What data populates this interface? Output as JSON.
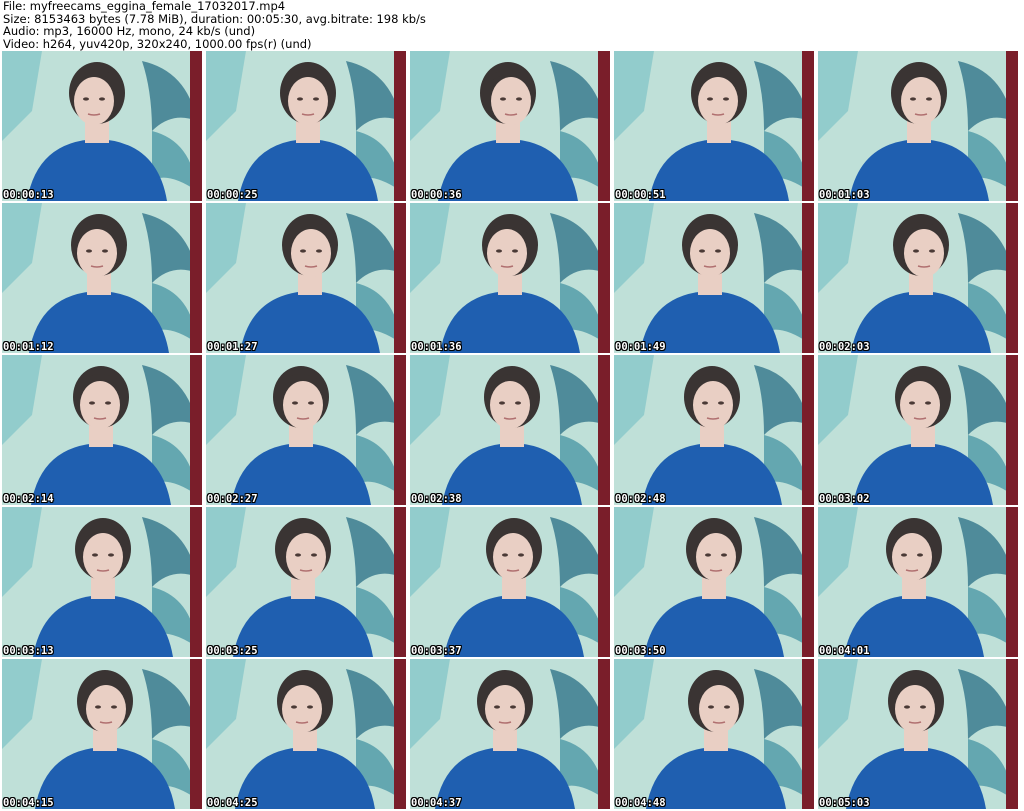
{
  "header": {
    "file": "File: myfreecams_eggina_female_17032017.mp4",
    "size": "Size: 8153463 bytes (7.78 MiB), duration: 00:05:30, avg.bitrate: 198 kb/s",
    "audio": "Audio: mp3, 16000 Hz, mono, 24 kb/s (und)",
    "video": "Video: h264, yuv420p, 320x240, 1000.00 fps(r) (und)"
  },
  "colors": {
    "background": "#ffffff",
    "wall": "#bfe0d8",
    "shirt": "#1f5fb0",
    "hair": "#3a3433",
    "skin": "#e9cfc4",
    "curtain": "#7a1e2a"
  },
  "thumbnails": [
    {
      "timestamp": "00:00:13"
    },
    {
      "timestamp": "00:00:25"
    },
    {
      "timestamp": "00:00:36"
    },
    {
      "timestamp": "00:00:51"
    },
    {
      "timestamp": "00:01:03"
    },
    {
      "timestamp": "00:01:12"
    },
    {
      "timestamp": "00:01:27"
    },
    {
      "timestamp": "00:01:36"
    },
    {
      "timestamp": "00:01:49"
    },
    {
      "timestamp": "00:02:03"
    },
    {
      "timestamp": "00:02:14"
    },
    {
      "timestamp": "00:02:27"
    },
    {
      "timestamp": "00:02:38"
    },
    {
      "timestamp": "00:02:48"
    },
    {
      "timestamp": "00:03:02"
    },
    {
      "timestamp": "00:03:13"
    },
    {
      "timestamp": "00:03:25"
    },
    {
      "timestamp": "00:03:37"
    },
    {
      "timestamp": "00:03:50"
    },
    {
      "timestamp": "00:04:01"
    },
    {
      "timestamp": "00:04:15"
    },
    {
      "timestamp": "00:04:25"
    },
    {
      "timestamp": "00:04:37"
    },
    {
      "timestamp": "00:04:48"
    },
    {
      "timestamp": "00:05:03"
    }
  ]
}
